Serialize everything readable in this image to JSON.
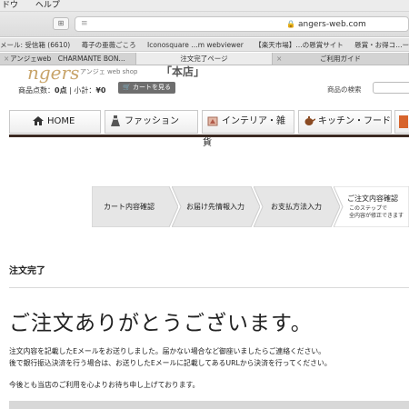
{
  "menubar": {
    "items": [
      "ドウ",
      "ヘルプ"
    ]
  },
  "browser": {
    "reader_icon": "≡",
    "grid_icon": "⊞",
    "url": "angers-web.com"
  },
  "bookmarks": [
    "メール: 受信箱 (6610)",
    "苺子の亜薇ごころ",
    "Iconosquare …m webviewer",
    "【楽天市場】…の懸賞サイト",
    "懸賞・お得コ…ーン情報満"
  ],
  "tabs": [
    {
      "label": "アンジェweb　CHARMANTE BON…",
      "active": false
    },
    {
      "label": "注文完了ページ",
      "active": true
    },
    {
      "label": "ご利用ガイド",
      "active": false
    }
  ],
  "site": {
    "logo": "ngers",
    "shop_label": "アンジェ web shop",
    "honten": "「本店」",
    "item_count_label": "商品点数：",
    "item_count": "0点",
    "subtotal_label": " | 小計：",
    "subtotal": "¥0",
    "cart_button": "カートを見る",
    "search_label": "商品の検索"
  },
  "nav": [
    {
      "label": "HOME",
      "icon": "home-icon"
    },
    {
      "label": "ファッション",
      "icon": "dress-icon"
    },
    {
      "label": "インテリア・雑貨",
      "icon": "interior-icon"
    },
    {
      "label": "キッチン・フード",
      "icon": "teapot-icon"
    }
  ],
  "steps": [
    {
      "label": "カート内容確認",
      "sub": ""
    },
    {
      "label": "お届け先情報入力",
      "sub": ""
    },
    {
      "label": "お支払方法入力",
      "sub": ""
    },
    {
      "label": "ご注文内容確認",
      "sub1": "このステップで",
      "sub2": "全内容が修正できます"
    }
  ],
  "content": {
    "section_title": "注文完了",
    "thanks": "ご注文ありがとうございます。",
    "line1": "注文内容を記載したEメールをお送りしました。届かない場合など御座いましたらご連絡ください。",
    "line2": "後で銀行振込決済を行う場合は、お送りしたEメールに記載してあるURLから決済を行ってください。",
    "line3": "今後とも当店のご利用を心よりお待ち申し上げております。"
  },
  "colors": {
    "brand_gold": "#c8a46a",
    "nav_rule": "#3b2a22"
  }
}
